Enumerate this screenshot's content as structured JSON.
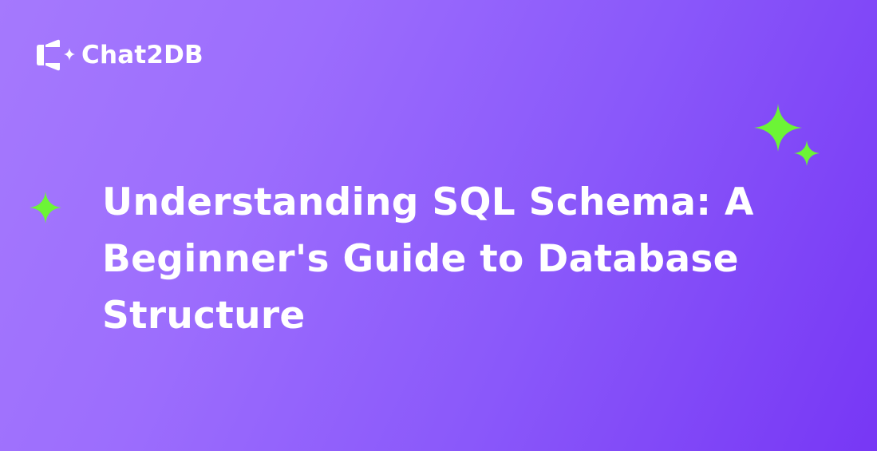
{
  "brand": {
    "name": "Chat2DB",
    "logo_icon": "chat2db-logo-icon"
  },
  "title": "Understanding SQL Schema: A Beginner's Guide to Database Structure",
  "decorations": {
    "sparkle_icon": "sparkle-icon",
    "sparkle_color": "#6cf536",
    "background_gradient": [
      "#a579fd",
      "#7737f5"
    ],
    "text_color": "#ffffff"
  }
}
